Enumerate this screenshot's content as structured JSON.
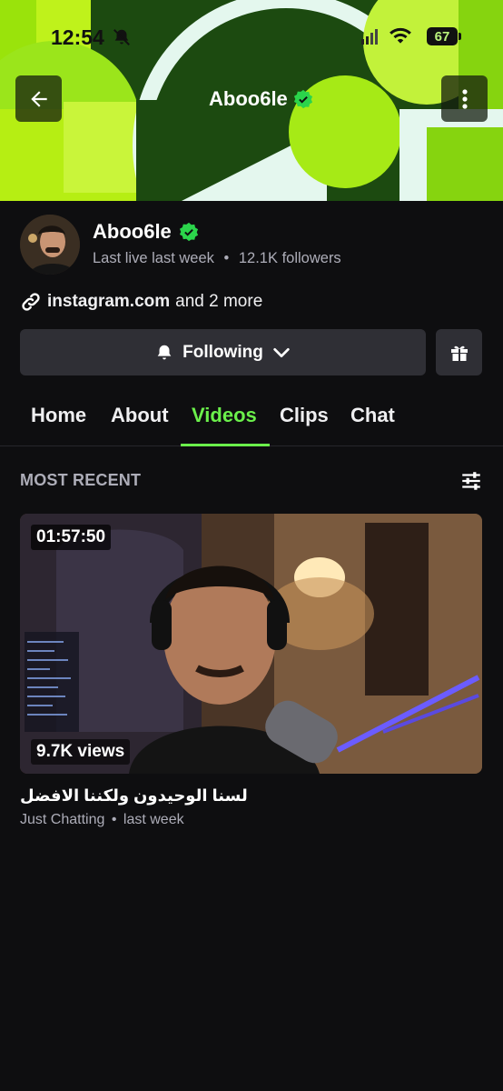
{
  "status_bar": {
    "time": "12:54",
    "battery": "67",
    "icons": [
      "bell-off-icon",
      "signal-icon",
      "wifi-icon",
      "battery-icon"
    ]
  },
  "header": {
    "channel_name": "Aboo6le",
    "back_icon": "arrow-left-icon",
    "more_icon": "vertical-dots-icon",
    "verified_icon": "verified-badge-icon"
  },
  "profile": {
    "name": "Aboo6le",
    "last_live": "Last live last week",
    "separator": "•",
    "followers": "12.1K followers"
  },
  "links": {
    "primary": "instagram.com",
    "more": "and 2 more",
    "icon": "link-icon"
  },
  "actions": {
    "follow_label": "Following",
    "follow_icon": "bell-icon",
    "chevron_icon": "chevron-down-icon",
    "gift_icon": "gift-icon"
  },
  "tabs": [
    {
      "label": "Home"
    },
    {
      "label": "About"
    },
    {
      "label": "Videos"
    },
    {
      "label": "Clips"
    },
    {
      "label": "Chat"
    }
  ],
  "active_tab": "Videos",
  "section": {
    "title": "MOST RECENT",
    "filter_icon": "sliders-icon"
  },
  "video": {
    "duration": "01:57:50",
    "views": "9.7K views",
    "title": "لسنا الوحيدون ولكننا الافضل",
    "category": "Just Chatting",
    "separator": "•",
    "posted": "last week"
  },
  "colors": {
    "accent": "#6bf04b",
    "background": "#0e0e10",
    "button": "#2f2f35",
    "muted_text": "#adadb8",
    "verified": "#2bd44b"
  }
}
